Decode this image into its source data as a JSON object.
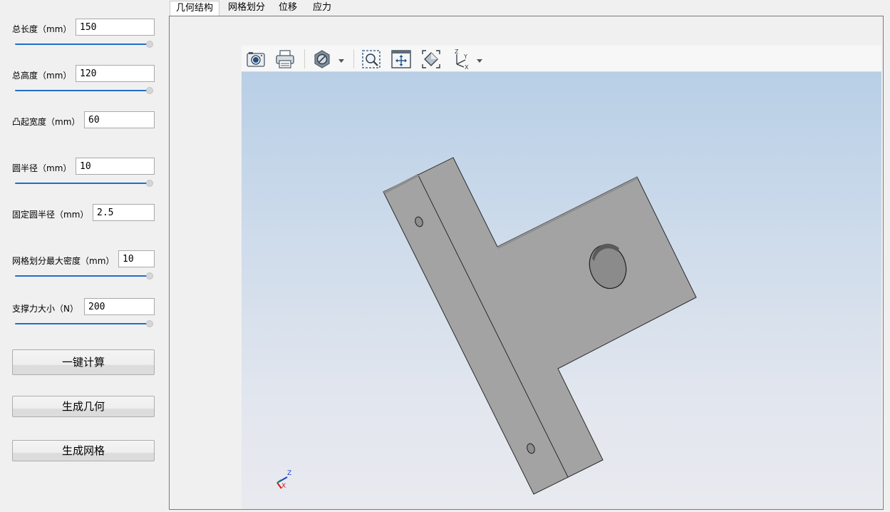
{
  "params": {
    "total_length": {
      "label": "总长度（mm）",
      "value": "150",
      "slider_fraction": 1.0
    },
    "total_height": {
      "label": "总高度（mm）",
      "value": "120",
      "slider_fraction": 1.0
    },
    "boss_width": {
      "label": "凸起宽度（mm）",
      "value": "60"
    },
    "circle_radius": {
      "label": "圆半径（mm）",
      "value": "10",
      "slider_fraction": 1.0
    },
    "fixed_circle_radius": {
      "label": "固定圆半径（mm）",
      "value": "2.5"
    },
    "mesh_max_density": {
      "label": "网格划分最大密度（mm）",
      "value": "10",
      "slider_fraction": 1.0
    },
    "support_force": {
      "label": "支撑力大小（N）",
      "value": "200",
      "slider_fraction": 1.0
    }
  },
  "buttons": {
    "one_click": "一键计算",
    "generate_geometry": "生成几何",
    "generate_mesh": "生成网格"
  },
  "tabs": [
    {
      "label": "几何结构",
      "active": true
    },
    {
      "label": "网格划分",
      "active": false
    },
    {
      "label": "位移",
      "active": false
    },
    {
      "label": "应力",
      "active": false
    }
  ],
  "toolbar": {
    "icons": [
      "camera-icon",
      "printer-icon",
      "display-mode-icon",
      "zoom-window-icon",
      "fit-all-icon",
      "view-fit-icon",
      "view-orientation-icon"
    ]
  },
  "axis_indicator": {
    "z": "Z",
    "x": "X"
  },
  "colors": {
    "slider_accent": "#1e6fc7",
    "model_face": "#a3a3a3",
    "background_top": "#b8cfe6",
    "background_bottom": "#e8eaef"
  }
}
